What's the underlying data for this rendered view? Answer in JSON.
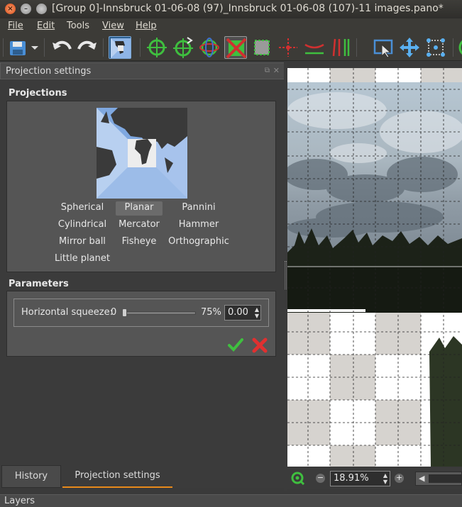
{
  "window": {
    "title": "[Group 0]-Innsbruck 01-06-08 (97)_Innsbruck 01-06-08 (107)-11 images.pano*"
  },
  "menu": {
    "items": [
      {
        "label": "File"
      },
      {
        "label": "Edit"
      },
      {
        "label": "Tools"
      },
      {
        "label": "View"
      },
      {
        "label": "Help"
      }
    ]
  },
  "toolbar": {
    "icons": [
      "save-icon",
      "undo-icon",
      "redo-icon",
      "projection-icon",
      "control-point-icon",
      "control-point-add-icon",
      "gyro-icon",
      "crop-active-icon",
      "crop-icon",
      "move-center-icon",
      "horizon-icon",
      "vertical-lines-icon",
      "select-icon",
      "move-icon",
      "points-icon"
    ]
  },
  "dock": {
    "title": "Projection settings"
  },
  "projections": {
    "heading": "Projections",
    "options": [
      {
        "label": "Spherical",
        "selected": false
      },
      {
        "label": "Planar",
        "selected": true
      },
      {
        "label": "Pannini",
        "selected": false
      },
      {
        "label": "Cylindrical",
        "selected": false
      },
      {
        "label": "Mercator",
        "selected": false
      },
      {
        "label": "Hammer",
        "selected": false
      },
      {
        "label": "Mirror ball",
        "selected": false
      },
      {
        "label": "Fisheye",
        "selected": false
      },
      {
        "label": "Orthographic",
        "selected": false
      },
      {
        "label": "Little planet",
        "selected": false
      }
    ]
  },
  "parameters": {
    "heading": "Parameters",
    "horizontal_squeeze": {
      "label": "Horizontal squeeze:",
      "min": "0",
      "max": "75%",
      "value": "0.00"
    }
  },
  "tabs": [
    {
      "label": "History",
      "active": false
    },
    {
      "label": "Projection settings",
      "active": true
    }
  ],
  "layers": {
    "label": "Layers"
  },
  "zoom": {
    "value": "18.91%"
  },
  "colors": {
    "accent": "#e88a1a",
    "selection": "#2b5e8f"
  }
}
